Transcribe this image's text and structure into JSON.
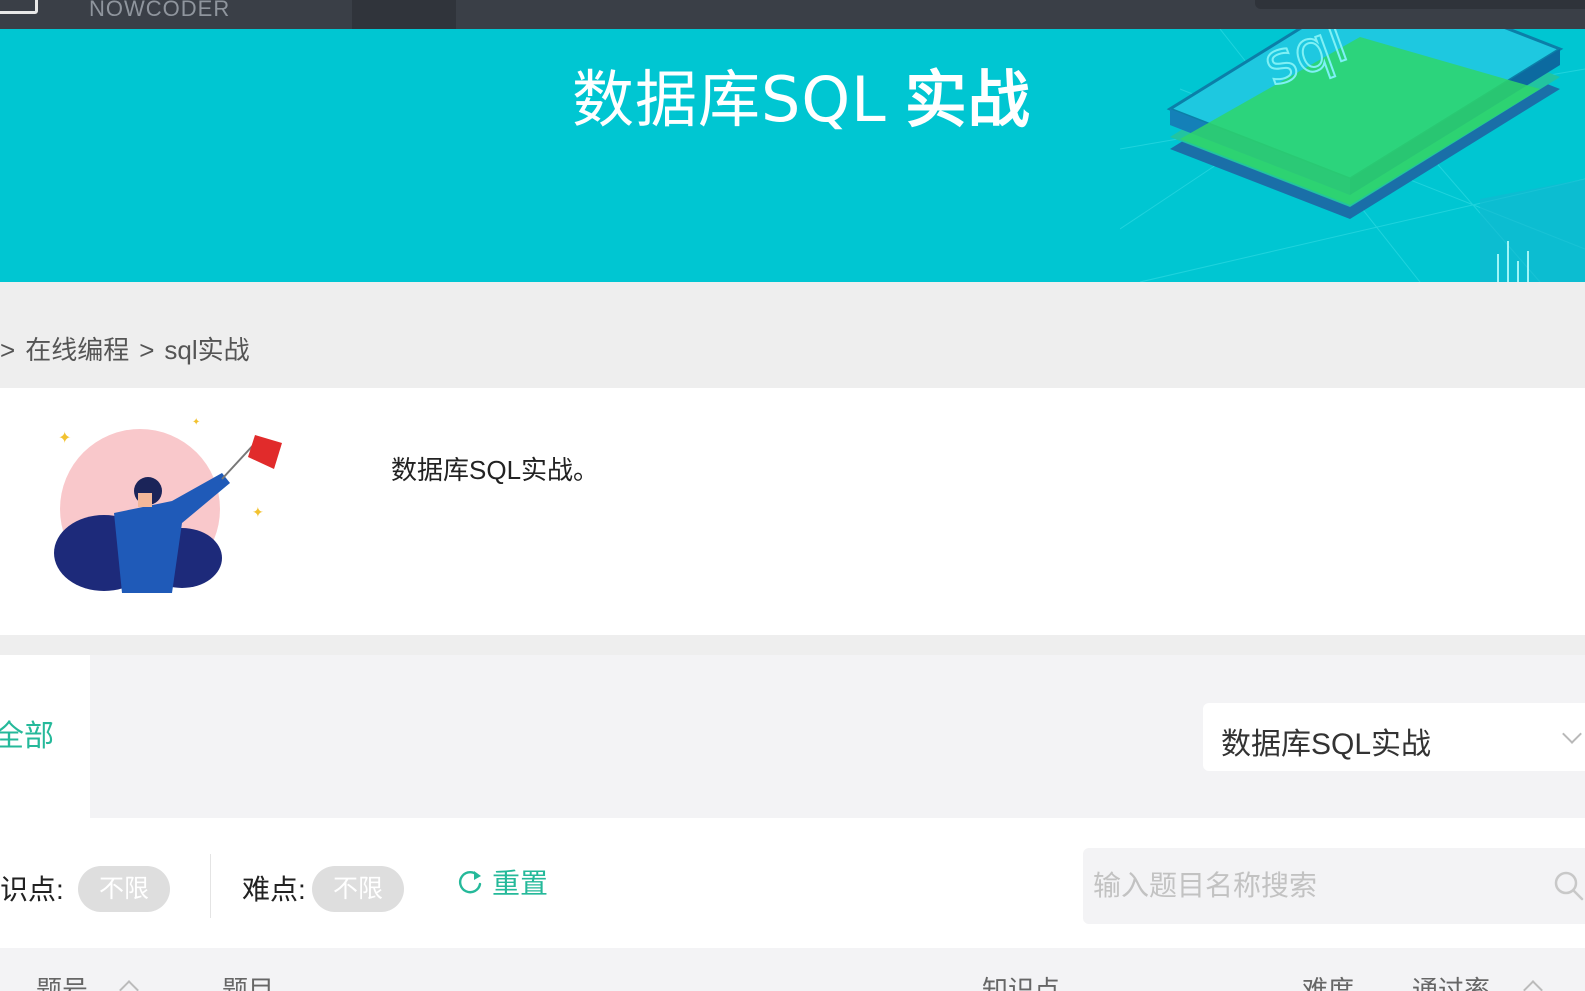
{
  "nav": {
    "brand": "NOWCODER"
  },
  "banner": {
    "title_main": "数据库SQL",
    "title_bold": "实战"
  },
  "breadcrumb": {
    "prefix": "",
    "sep1": ">",
    "item1": "在线编程",
    "sep2": ">",
    "item2": "sql实战"
  },
  "intro": {
    "description": "数据库SQL实战。"
  },
  "tabs": {
    "all_label": "全部"
  },
  "set_select": {
    "value": "数据库SQL实战"
  },
  "filters": {
    "knowledge_label": "识点:",
    "knowledge_value": "不限",
    "difficulty_label": "难点:",
    "difficulty_value": "不限",
    "reset_label": "重置"
  },
  "search": {
    "placeholder": "输入题目名称搜索"
  },
  "table": {
    "columns": [
      "题号",
      "题目",
      "知识点",
      "难度",
      "通过率"
    ]
  },
  "colors": {
    "accent": "#25b99a",
    "banner": "#00c6d2",
    "topbar": "#3a3f47"
  }
}
